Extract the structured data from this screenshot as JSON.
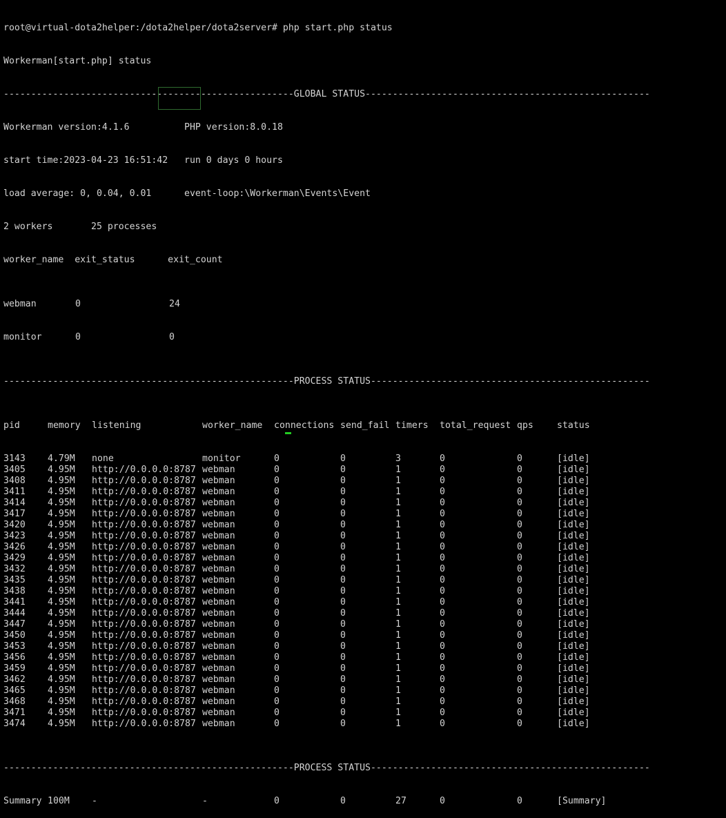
{
  "terminal": {
    "prompt_line": "root@virtual-dota2helper:/dota2helper/dota2server# php start.php status",
    "workerman_line": "Workerman[start.php] status",
    "global_status_header": "-----------------------------------------------------GLOBAL STATUS----------------------------------------------------",
    "version_line": "Workerman version:4.1.6          PHP version:8.0.18",
    "start_time_line": "start time:2023-04-23 16:51:42   run 0 days 0 hours",
    "load_line": "load average: 0, 0.04, 0.01      event-loop:\\Workerman\\Events\\Event",
    "workers_line": "2 workers       25 processes",
    "worker_table_header": "worker_name  exit_status      exit_count",
    "workers": [
      {
        "name": "webman",
        "exit_status": "0",
        "exit_count": "24"
      },
      {
        "name": "monitor",
        "exit_status": "0",
        "exit_count": "0"
      }
    ],
    "process_status_header": "-----------------------------------------------------PROCESS STATUS---------------------------------------------------",
    "process_columns": [
      "pid",
      "memory",
      "listening",
      "worker_name",
      "connections",
      "send_fail",
      "timers",
      "total_request",
      "qps",
      "status"
    ],
    "processes": [
      {
        "pid": "3143",
        "memory": "4.79M",
        "listening": "none",
        "worker_name": "monitor",
        "connections": "0",
        "send_fail": "0",
        "timers": "3",
        "total_request": "0",
        "qps": "0",
        "status": "[idle]"
      },
      {
        "pid": "3405",
        "memory": "4.95M",
        "listening": "http://0.0.0.0:8787",
        "worker_name": "webman",
        "connections": "0",
        "send_fail": "0",
        "timers": "1",
        "total_request": "0",
        "qps": "0",
        "status": "[idle]"
      },
      {
        "pid": "3408",
        "memory": "4.95M",
        "listening": "http://0.0.0.0:8787",
        "worker_name": "webman",
        "connections": "0",
        "send_fail": "0",
        "timers": "1",
        "total_request": "0",
        "qps": "0",
        "status": "[idle]"
      },
      {
        "pid": "3411",
        "memory": "4.95M",
        "listening": "http://0.0.0.0:8787",
        "worker_name": "webman",
        "connections": "0",
        "send_fail": "0",
        "timers": "1",
        "total_request": "0",
        "qps": "0",
        "status": "[idle]"
      },
      {
        "pid": "3414",
        "memory": "4.95M",
        "listening": "http://0.0.0.0:8787",
        "worker_name": "webman",
        "connections": "0",
        "send_fail": "0",
        "timers": "1",
        "total_request": "0",
        "qps": "0",
        "status": "[idle]"
      },
      {
        "pid": "3417",
        "memory": "4.95M",
        "listening": "http://0.0.0.0:8787",
        "worker_name": "webman",
        "connections": "0",
        "send_fail": "0",
        "timers": "1",
        "total_request": "0",
        "qps": "0",
        "status": "[idle]"
      },
      {
        "pid": "3420",
        "memory": "4.95M",
        "listening": "http://0.0.0.0:8787",
        "worker_name": "webman",
        "connections": "0",
        "send_fail": "0",
        "timers": "1",
        "total_request": "0",
        "qps": "0",
        "status": "[idle]"
      },
      {
        "pid": "3423",
        "memory": "4.95M",
        "listening": "http://0.0.0.0:8787",
        "worker_name": "webman",
        "connections": "0",
        "send_fail": "0",
        "timers": "1",
        "total_request": "0",
        "qps": "0",
        "status": "[idle]"
      },
      {
        "pid": "3426",
        "memory": "4.95M",
        "listening": "http://0.0.0.0:8787",
        "worker_name": "webman",
        "connections": "0",
        "send_fail": "0",
        "timers": "1",
        "total_request": "0",
        "qps": "0",
        "status": "[idle]"
      },
      {
        "pid": "3429",
        "memory": "4.95M",
        "listening": "http://0.0.0.0:8787",
        "worker_name": "webman",
        "connections": "0",
        "send_fail": "0",
        "timers": "1",
        "total_request": "0",
        "qps": "0",
        "status": "[idle]"
      },
      {
        "pid": "3432",
        "memory": "4.95M",
        "listening": "http://0.0.0.0:8787",
        "worker_name": "webman",
        "connections": "0",
        "send_fail": "0",
        "timers": "1",
        "total_request": "0",
        "qps": "0",
        "status": "[idle]"
      },
      {
        "pid": "3435",
        "memory": "4.95M",
        "listening": "http://0.0.0.0:8787",
        "worker_name": "webman",
        "connections": "0",
        "send_fail": "0",
        "timers": "1",
        "total_request": "0",
        "qps": "0",
        "status": "[idle]"
      },
      {
        "pid": "3438",
        "memory": "4.95M",
        "listening": "http://0.0.0.0:8787",
        "worker_name": "webman",
        "connections": "0",
        "send_fail": "0",
        "timers": "1",
        "total_request": "0",
        "qps": "0",
        "status": "[idle]"
      },
      {
        "pid": "3441",
        "memory": "4.95M",
        "listening": "http://0.0.0.0:8787",
        "worker_name": "webman",
        "connections": "0",
        "send_fail": "0",
        "timers": "1",
        "total_request": "0",
        "qps": "0",
        "status": "[idle]"
      },
      {
        "pid": "3444",
        "memory": "4.95M",
        "listening": "http://0.0.0.0:8787",
        "worker_name": "webman",
        "connections": "0",
        "send_fail": "0",
        "timers": "1",
        "total_request": "0",
        "qps": "0",
        "status": "[idle]"
      },
      {
        "pid": "3447",
        "memory": "4.95M",
        "listening": "http://0.0.0.0:8787",
        "worker_name": "webman",
        "connections": "0",
        "send_fail": "0",
        "timers": "1",
        "total_request": "0",
        "qps": "0",
        "status": "[idle]"
      },
      {
        "pid": "3450",
        "memory": "4.95M",
        "listening": "http://0.0.0.0:8787",
        "worker_name": "webman",
        "connections": "0",
        "send_fail": "0",
        "timers": "1",
        "total_request": "0",
        "qps": "0",
        "status": "[idle]"
      },
      {
        "pid": "3453",
        "memory": "4.95M",
        "listening": "http://0.0.0.0:8787",
        "worker_name": "webman",
        "connections": "0",
        "send_fail": "0",
        "timers": "1",
        "total_request": "0",
        "qps": "0",
        "status": "[idle]"
      },
      {
        "pid": "3456",
        "memory": "4.95M",
        "listening": "http://0.0.0.0:8787",
        "worker_name": "webman",
        "connections": "0",
        "send_fail": "0",
        "timers": "1",
        "total_request": "0",
        "qps": "0",
        "status": "[idle]"
      },
      {
        "pid": "3459",
        "memory": "4.95M",
        "listening": "http://0.0.0.0:8787",
        "worker_name": "webman",
        "connections": "0",
        "send_fail": "0",
        "timers": "1",
        "total_request": "0",
        "qps": "0",
        "status": "[idle]"
      },
      {
        "pid": "3462",
        "memory": "4.95M",
        "listening": "http://0.0.0.0:8787",
        "worker_name": "webman",
        "connections": "0",
        "send_fail": "0",
        "timers": "1",
        "total_request": "0",
        "qps": "0",
        "status": "[idle]"
      },
      {
        "pid": "3465",
        "memory": "4.95M",
        "listening": "http://0.0.0.0:8787",
        "worker_name": "webman",
        "connections": "0",
        "send_fail": "0",
        "timers": "1",
        "total_request": "0",
        "qps": "0",
        "status": "[idle]"
      },
      {
        "pid": "3468",
        "memory": "4.95M",
        "listening": "http://0.0.0.0:8787",
        "worker_name": "webman",
        "connections": "0",
        "send_fail": "0",
        "timers": "1",
        "total_request": "0",
        "qps": "0",
        "status": "[idle]"
      },
      {
        "pid": "3471",
        "memory": "4.95M",
        "listening": "http://0.0.0.0:8787",
        "worker_name": "webman",
        "connections": "0",
        "send_fail": "0",
        "timers": "1",
        "total_request": "0",
        "qps": "0",
        "status": "[idle]"
      },
      {
        "pid": "3474",
        "memory": "4.95M",
        "listening": "http://0.0.0.0:8787",
        "worker_name": "webman",
        "connections": "0",
        "send_fail": "0",
        "timers": "1",
        "total_request": "0",
        "qps": "0",
        "status": "[idle]"
      }
    ],
    "summary": {
      "pid": "Summary",
      "memory": "100M",
      "listening": "-",
      "worker_name": "-",
      "connections": "0",
      "send_fail": "0",
      "timers": "27",
      "total_request": "0",
      "qps": "0",
      "status": "[Summary]"
    },
    "cursor_color": "#22cc22",
    "highlight_color": "#2f6b2f"
  }
}
